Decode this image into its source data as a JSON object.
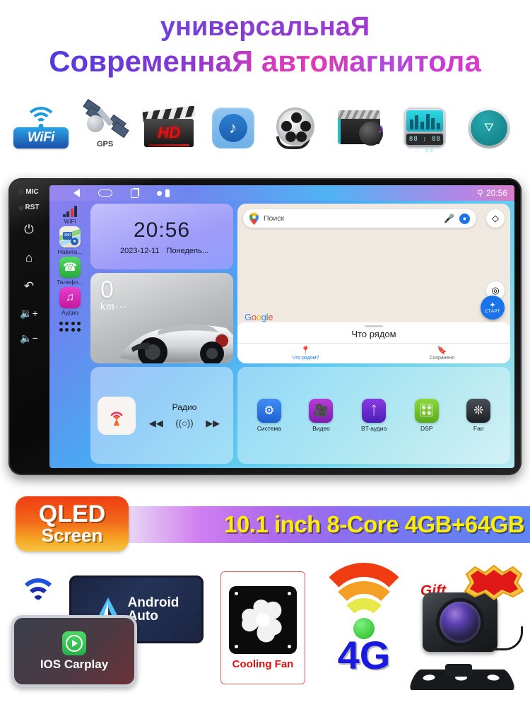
{
  "header": {
    "line1": "универсальнаЯ",
    "line2": "СовременнаЯ автомагнитола"
  },
  "feature_icons": [
    {
      "name": "wifi-icon",
      "label": "WiFi"
    },
    {
      "name": "gps-satellite-icon",
      "label": "GPS"
    },
    {
      "name": "hd-clapperboard-icon",
      "label": "HD"
    },
    {
      "name": "music-note-icon",
      "label": ""
    },
    {
      "name": "film-reel-icon",
      "label": ""
    },
    {
      "name": "video-audio-icon",
      "label": ""
    },
    {
      "name": "equalizer-radio-icon",
      "label": ""
    },
    {
      "name": "usb-icon",
      "label": ""
    }
  ],
  "icon_strip_extra": {
    "eq_lcd": "88 : 88 : 88"
  },
  "device": {
    "bezel_buttons": [
      {
        "name": "mic-indicator",
        "label": "MIC",
        "type": "led"
      },
      {
        "name": "reset-button",
        "label": "RST",
        "type": "led"
      },
      {
        "name": "power-button",
        "glyph": "⏻"
      },
      {
        "name": "home-button",
        "glyph": "⌂"
      },
      {
        "name": "back-button",
        "glyph": "↩"
      },
      {
        "name": "volume-up-button",
        "glyph": "🔊+"
      },
      {
        "name": "volume-down-button",
        "glyph": "🔊−"
      }
    ],
    "statusbar": {
      "time": "20:56",
      "location_icon": "location-pin-icon"
    },
    "rail": [
      {
        "name": "wifi-signal",
        "label": "WiFi"
      },
      {
        "name": "navigation-app",
        "label": "Навига..."
      },
      {
        "name": "phone-app",
        "label": "Телефо..."
      },
      {
        "name": "audio-app",
        "label": "Аудио"
      }
    ],
    "clock_widget": {
      "time": "20:56",
      "date": "2023-12-11",
      "weekday": "Понедель..."
    },
    "car_widget": {
      "value": "0",
      "unit": "km···"
    },
    "radio_widget": {
      "title": "Радио",
      "prev": "◀◀",
      "tune": "((○))",
      "next": "▶▶"
    },
    "map_widget": {
      "search_placeholder": "Поиск",
      "mic": "mic-icon",
      "account": "account-icon",
      "layers": "layers-icon",
      "locate": "locate-icon",
      "google_letters": [
        "G",
        "o",
        "o",
        "g",
        "l",
        "e"
      ],
      "start_button": "СТАРТ",
      "sheet_title": "Что рядом",
      "tabs": [
        {
          "name": "nearby-tab",
          "label": "Что рядом?",
          "icon": "pin-icon",
          "active": true
        },
        {
          "name": "saved-tab",
          "label": "Сохранено",
          "icon": "bookmark-icon",
          "active": false
        }
      ]
    },
    "dock": [
      {
        "name": "system-app",
        "label": "Система"
      },
      {
        "name": "video-app",
        "label": "Видео"
      },
      {
        "name": "bluetooth-audio-app",
        "label": "BT-аудио"
      },
      {
        "name": "dsp-app",
        "label": "DSP"
      },
      {
        "name": "fan-app",
        "label": "Fan"
      }
    ]
  },
  "qled_badge": {
    "line1": "QLED",
    "line2": "Screen"
  },
  "spec_banner": {
    "text": "10.1 inch 8-Core 4GB+64GB"
  },
  "bottom_features": {
    "android_auto": "Android\nAuto",
    "android_auto_line1": "Android",
    "android_auto_line2": "Auto",
    "ios_carplay": "IOS Carplay",
    "cooling_fan": "Cooling Fan",
    "network": "4G",
    "gift": "Gift"
  },
  "colors": {
    "title_purple": "#7b3fd6",
    "banner_yellow": "#ffee00",
    "qled_orange": "#ef3d12",
    "accent_blue": "#1a73e8",
    "green_4g": "#23b723",
    "red_fan": "#e01010"
  }
}
